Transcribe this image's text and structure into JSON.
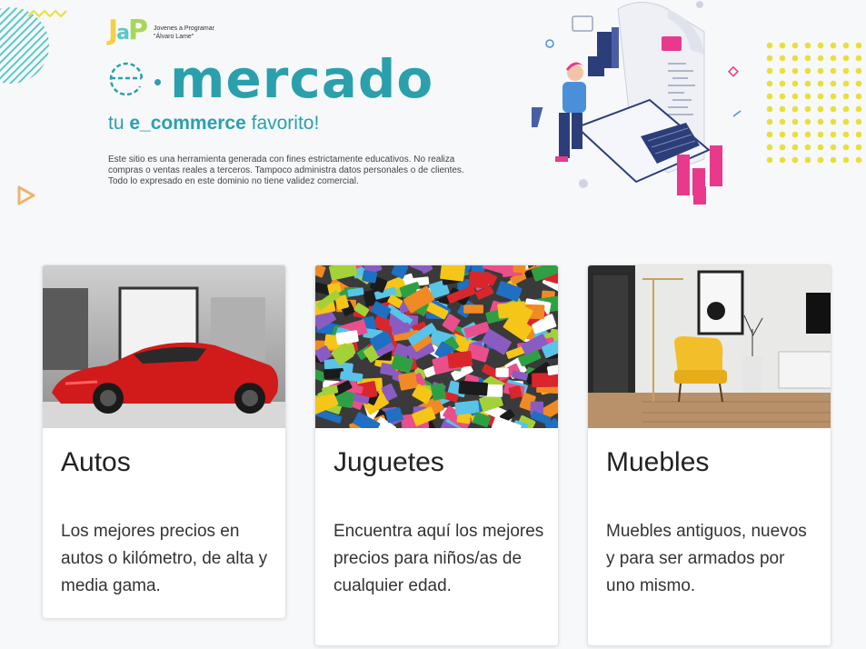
{
  "logo": {
    "letters": [
      "J",
      "a",
      "P"
    ],
    "line1": "Jovenes a Programar",
    "line2": "\"Álvaro Lame\""
  },
  "brand": {
    "prefix": "e",
    "title": "mercado",
    "color": "#2aa0ad"
  },
  "tagline": {
    "pre": "tu ",
    "bold": "e_commerce",
    "post": " favorito!"
  },
  "disclaimer": "Este sitio  es una herramienta generada con fines estrictamente educativos. No realiza compras o ventas reales a terceros. Tampoco administra datos personales o de clientes. Todo lo expresado en este dominio no tiene validez comercial.",
  "categories": [
    {
      "title": "Autos",
      "description": "Los mejores precios en autos o kilómetro, de alta y media gama.",
      "image_icon": "red-sports-car-image"
    },
    {
      "title": "Juguetes",
      "description": "Encuentra aquí los mejores precios para niños/as de cualquier edad.",
      "image_icon": "lego-bricks-image"
    },
    {
      "title": "Muebles",
      "description": "Muebles antiguos, nuevos y para ser armados por uno mismo.",
      "image_icon": "yellow-armchair-room-image"
    }
  ],
  "colors": {
    "accent": "#2aa0ad",
    "yellow": "#e8df3a",
    "pink": "#e8398c",
    "navy": "#2c3e7a"
  }
}
